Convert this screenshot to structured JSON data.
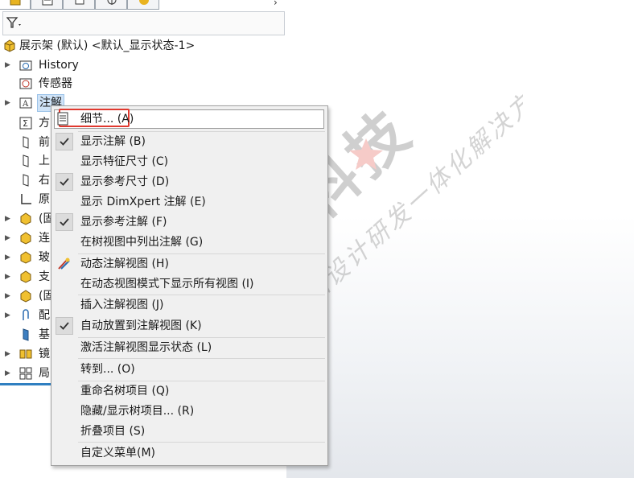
{
  "tree": {
    "root_label": "展示架 (默认) <默认_显示状态-1>",
    "history_label": "History",
    "sensors_label": "传感器",
    "annotations_label": "注解",
    "equations_label": "方",
    "front_plane_label": "前",
    "top_plane_label": "上",
    "right_plane_label": "右",
    "origin_label": "原",
    "part1_label": "(固",
    "part2_label": "连",
    "part3_label": "玻",
    "part4_label": "支",
    "part5_label": "(固",
    "mates_label": "配",
    "base_label": "基",
    "mirror_label": "镜",
    "pattern_label": "局"
  },
  "menu": {
    "items": [
      "细节... (A)",
      "显示注解 (B)",
      "显示特征尺寸 (C)",
      "显示参考尺寸 (D)",
      "显示 DimXpert 注解 (E)",
      "显示参考注解 (F)",
      "在树视图中列出注解 (G)",
      "动态注解视图 (H)",
      "在动态视图模式下显示所有视图 (I)",
      "插入注解视图 (J)",
      "自动放置到注解视图 (K)",
      "激活注解视图显示状态 (L)",
      "转到... (O)",
      "重命名树项目 (Q)",
      "隐藏/显示树项目... (R)",
      "折叠项目 (S)",
      "自定义菜单(M)"
    ]
  },
  "watermark": {
    "main_text": "生信科技",
    "sub_text": "产品设计研发一体化解决方案"
  }
}
